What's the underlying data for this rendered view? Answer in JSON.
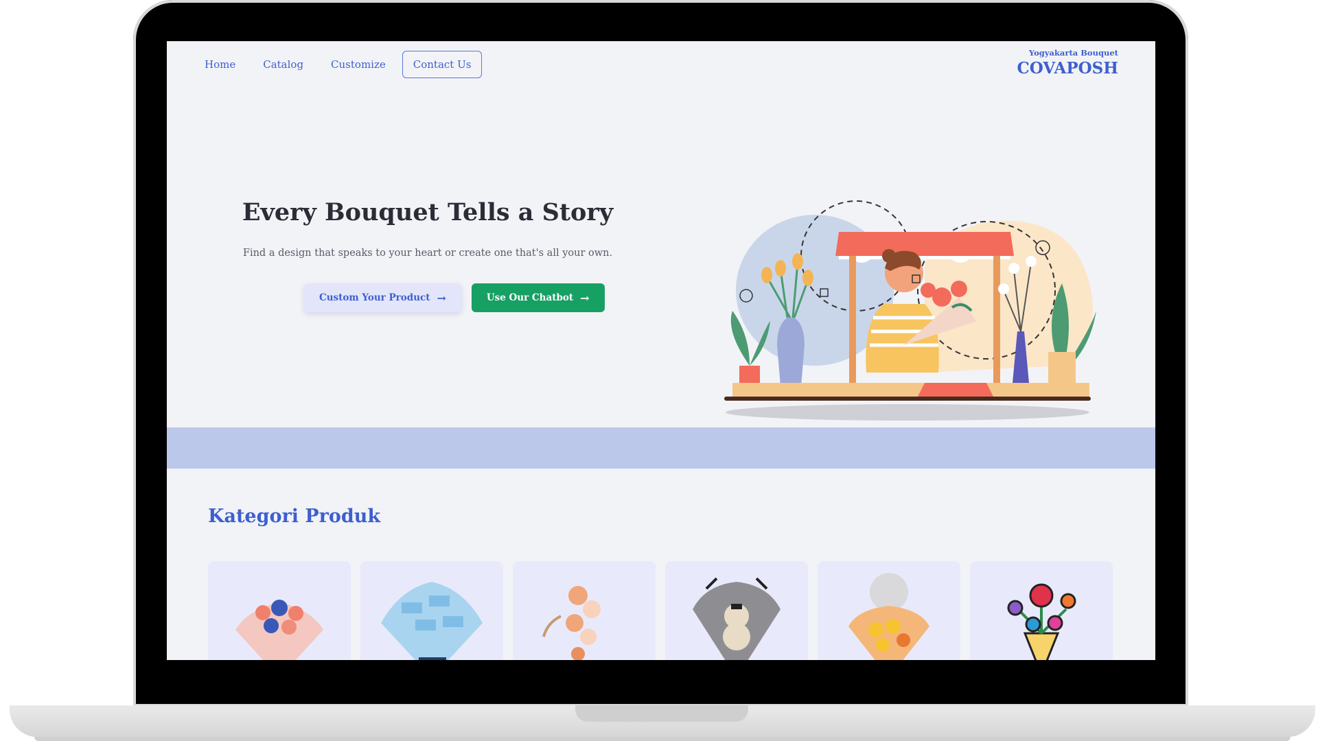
{
  "nav": {
    "links": [
      "Home",
      "Catalog",
      "Customize",
      "Contact Us"
    ]
  },
  "brand": {
    "tagline": "Yogyakarta Bouquet",
    "name": "COVAPOSH"
  },
  "hero": {
    "title": "Every Bouquet Tells a Story",
    "subtitle": "Find a design that speaks to your heart or create one that's all your own.",
    "btn_custom": "Custom Your Product",
    "btn_chatbot": "Use Our Chatbot"
  },
  "section": {
    "title": "Kategori Produk"
  },
  "icons": {
    "arrow": "arrow-right-icon"
  },
  "colors": {
    "accent": "#3d5fcf",
    "cta": "#17a064",
    "band": "#bcc8ea",
    "card_bg": "#e8eafb"
  }
}
